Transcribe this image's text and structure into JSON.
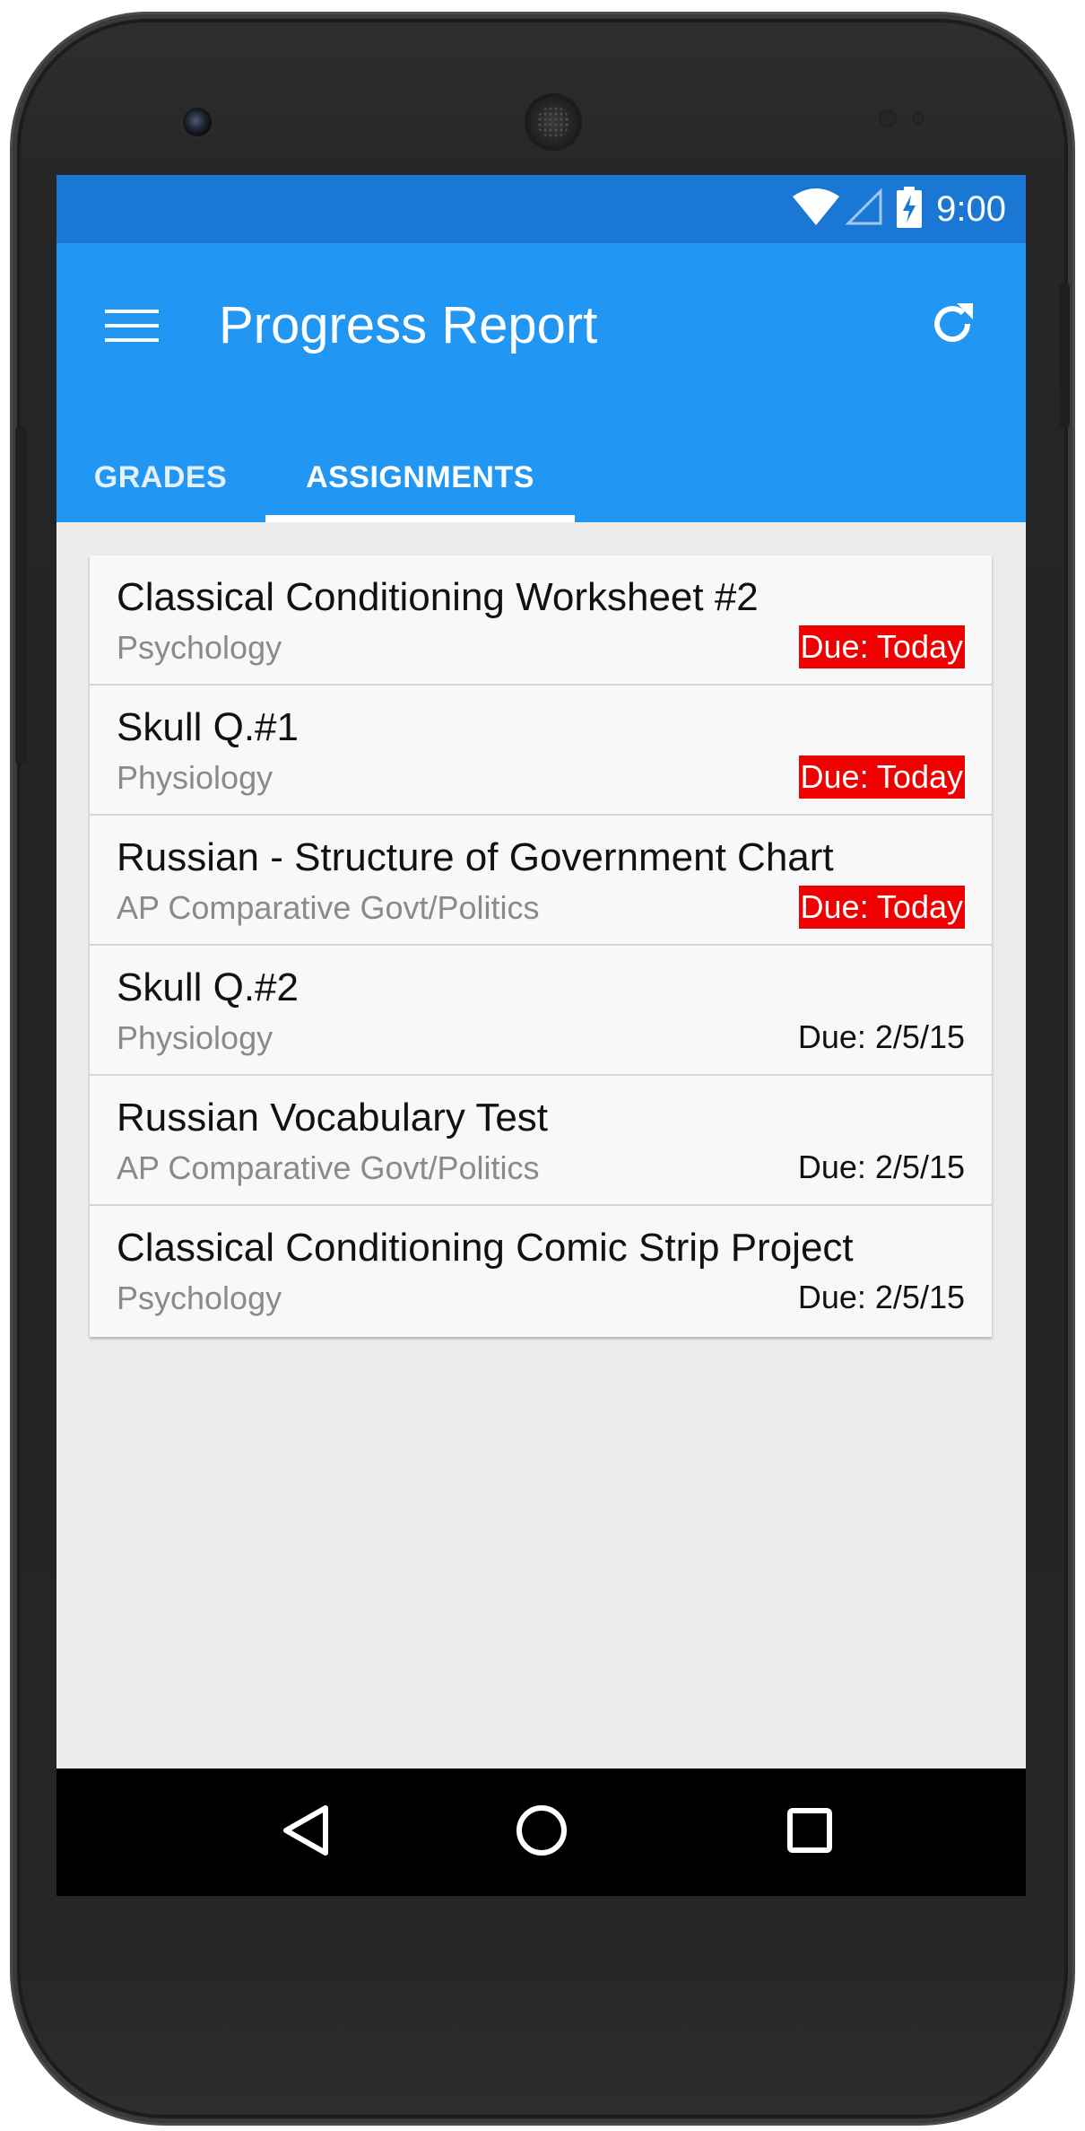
{
  "status_bar": {
    "time": "9:00",
    "icons": [
      "wifi-icon",
      "cell-signal-icon",
      "battery-charging-icon"
    ]
  },
  "app_bar": {
    "title": "Progress Report",
    "menu_icon": "hamburger-menu-icon",
    "refresh_icon": "refresh-icon"
  },
  "tabs": [
    {
      "label": "GRADES",
      "selected": false
    },
    {
      "label": "ASSIGNMENTS",
      "selected": true
    }
  ],
  "assignments": [
    {
      "title": "Classical Conditioning Worksheet #2",
      "subject": "Psychology",
      "due": "Due: Today",
      "urgent": true
    },
    {
      "title": "Skull Q.#1",
      "subject": "Physiology",
      "due": "Due: Today",
      "urgent": true
    },
    {
      "title": "Russian - Structure of Government Chart",
      "subject": "AP Comparative Govt/Politics",
      "due": "Due: Today",
      "urgent": true
    },
    {
      "title": "Skull Q.#2",
      "subject": "Physiology",
      "due": "Due: 2/5/15",
      "urgent": false
    },
    {
      "title": "Russian Vocabulary Test",
      "subject": "AP Comparative Govt/Politics",
      "due": "Due: 2/5/15",
      "urgent": false
    },
    {
      "title": "Classical Conditioning Comic Strip Project",
      "subject": "Psychology",
      "due": "Due: 2/5/15",
      "urgent": false
    }
  ],
  "nav_bar": {
    "icons": [
      "back-icon",
      "home-icon",
      "recents-icon"
    ]
  },
  "colors": {
    "status_bar": "#1a78d4",
    "app_bar": "#2196f3",
    "urgent_badge": "#f00000",
    "background": "#ececec",
    "card": "#f8f8f8"
  }
}
